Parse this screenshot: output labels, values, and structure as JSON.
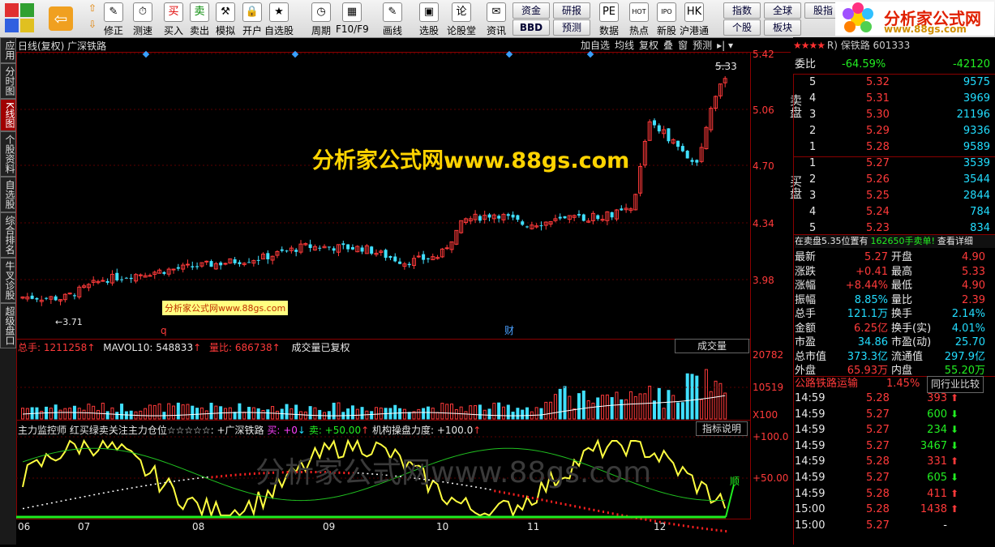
{
  "toolbar": {
    "buttons": [
      {
        "label": "修正"
      },
      {
        "label": "测速"
      },
      {
        "label": "买入"
      },
      {
        "label": "卖出"
      },
      {
        "label": "模拟"
      },
      {
        "label": "开户"
      },
      {
        "label": "自选股"
      },
      {
        "label": "周期"
      },
      {
        "label": "F10/F9"
      },
      {
        "label": "画线"
      },
      {
        "label": "选股"
      },
      {
        "label": "论股堂"
      },
      {
        "label": "资讯"
      },
      {
        "label": "数据"
      },
      {
        "label": "热点"
      },
      {
        "label": "新股"
      },
      {
        "label": "沪港通"
      }
    ],
    "small": [
      "资金",
      "BBD",
      "研报",
      "预测",
      "指数",
      "全球",
      "股指",
      "个股",
      "板块"
    ],
    "buy_glyph": "买",
    "sell_glyph": "卖",
    "logo_text": "分析家公式网",
    "logo_url": "www.88gs.com"
  },
  "sidebar": [
    "应用",
    "分时图",
    "K线图",
    "个股资料",
    "自选股",
    "综合排名",
    "牛叉诊股",
    "超级盘口"
  ],
  "chart": {
    "title": "日线(复权) 广深铁路",
    "top_buttons": [
      "加自选",
      "均线",
      "复权",
      "叠",
      "窗",
      "预测"
    ],
    "price_axis": [
      "5.42",
      "5.06",
      "4.70",
      "4.34",
      "3.98"
    ],
    "high_label": "5.33",
    "low_label": "3.71",
    "watermark": "分析家公式网www.88gs.com",
    "small_watermark": "分析家公式网www.88gs.com",
    "marker_q": "q",
    "marker_cai": "财",
    "vol_header": {
      "total_label": "总手:",
      "total_value": "1211258",
      "mavol": "MAVOL10: 548833",
      "lb_label": "量比:",
      "lb_value": "686738",
      "note": "成交量已复权",
      "btn": "成交量"
    },
    "vol_axis": [
      "20782",
      "10519",
      "X100"
    ],
    "ind_header": {
      "name": "主力监控师 红买绿卖关注主力仓位☆☆☆☆☆: +广深铁路",
      "buy": "买: +0",
      "sell": "卖: +50.00",
      "inst": "机构操盘力度: +100.0",
      "btn": "指标说明"
    },
    "ind_axis": [
      "+100.0",
      "+50.00"
    ],
    "ind_tag": "顺",
    "big_watermark": "分析家公式网www.88gs.com",
    "months": [
      "06",
      "07",
      "08",
      "09",
      "10",
      "11",
      "12"
    ]
  },
  "panel": {
    "header": "R) 保铁路 601333",
    "wb_label": "委比",
    "wb_pct": "-64.59%",
    "wb_val": "-42120",
    "sell_label": "卖盘",
    "buy_label": "买盘",
    "asks": [
      {
        "lv": "5",
        "p": "5.32",
        "v": "9575"
      },
      {
        "lv": "4",
        "p": "5.31",
        "v": "3969"
      },
      {
        "lv": "3",
        "p": "5.30",
        "v": "21196"
      },
      {
        "lv": "2",
        "p": "5.29",
        "v": "9336"
      },
      {
        "lv": "1",
        "p": "5.28",
        "v": "9589"
      }
    ],
    "bids": [
      {
        "lv": "1",
        "p": "5.27",
        "v": "3539"
      },
      {
        "lv": "2",
        "p": "5.26",
        "v": "3544"
      },
      {
        "lv": "3",
        "p": "5.25",
        "v": "2844"
      },
      {
        "lv": "4",
        "p": "5.24",
        "v": "784"
      },
      {
        "lv": "5",
        "p": "5.23",
        "v": "834"
      }
    ],
    "notice_a": "在卖盘5.35位置有",
    "notice_b": "162650手卖单!",
    "notice_c": "查看详细",
    "stats": [
      [
        "最新",
        "5.27",
        "开盘",
        "4.90"
      ],
      [
        "涨跌",
        "+0.41",
        "最高",
        "5.33"
      ],
      [
        "涨幅",
        "+8.44%",
        "最低",
        "4.90"
      ],
      [
        "振幅",
        "8.85%",
        "量比",
        "2.39"
      ],
      [
        "总手",
        "121.1万",
        "换手",
        "2.14%"
      ],
      [
        "金额",
        "6.25亿",
        "换手(实)",
        "4.01%"
      ],
      [
        "市盈",
        "34.86",
        "市盈(动)",
        "25.70"
      ],
      [
        "总市值",
        "373.3亿",
        "流通值",
        "297.9亿"
      ],
      [
        "外盘",
        "65.93万",
        "内盘",
        "55.20万"
      ]
    ],
    "sector": "公路铁路运输",
    "sector_pct": "1.45%",
    "sector_btn": "同行业比较",
    "ticks": [
      [
        "14:59",
        "5.28",
        "393",
        "up"
      ],
      [
        "14:59",
        "5.27",
        "600",
        "dn"
      ],
      [
        "14:59",
        "5.27",
        "234",
        "dn"
      ],
      [
        "14:59",
        "5.27",
        "3467",
        "dn"
      ],
      [
        "14:59",
        "5.28",
        "331",
        "up"
      ],
      [
        "14:59",
        "5.27",
        "605",
        "dn"
      ],
      [
        "14:59",
        "5.28",
        "411",
        "up"
      ],
      [
        "15:00",
        "5.28",
        "1438",
        "up"
      ],
      [
        "15:00",
        "5.27",
        "-",
        "-"
      ]
    ]
  }
}
